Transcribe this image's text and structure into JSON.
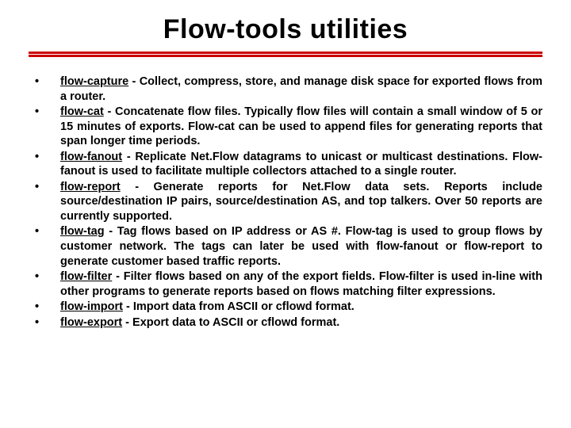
{
  "title": "Flow-tools utilities",
  "items": [
    {
      "name": "flow-capture",
      "desc": " - Collect, compress, store, and manage disk space for exported flows from a router."
    },
    {
      "name": "flow-cat",
      "desc": " - Concatenate flow files.  Typically flow files will contain a small window of 5 or 15 minutes of exports.  Flow-cat can be used to append files for generating reports that span longer time periods."
    },
    {
      "name": "flow-fanout",
      "desc": "  - Replicate Net.Flow datagrams to unicast or multicast destinations.  Flow-fanout is used to facilitate multiple collectors attached to a single router."
    },
    {
      "name": "flow-report",
      "desc": "  - Generate reports for Net.Flow data sets.  Reports include source/destination IP pairs, source/destination AS, and top talkers.  Over 50 reports are currently supported."
    },
    {
      "name": "flow-tag",
      "desc": "  - Tag flows based on IP address or AS #.  Flow-tag is used to group flows by customer network.  The tags can later be used with flow-fanout or flow-report to generate customer based traffic reports."
    },
    {
      "name": "flow-filter",
      "desc": "  -  Filter flows based on any of the export fields.  Flow-filter is used in-line with other programs to generate reports based on flows matching filter expressions."
    },
    {
      "name": "flow-import",
      "desc": " - Import data from ASCII or cflowd format."
    },
    {
      "name": "flow-export",
      "desc": " - Export data to ASCII or cflowd format."
    }
  ]
}
